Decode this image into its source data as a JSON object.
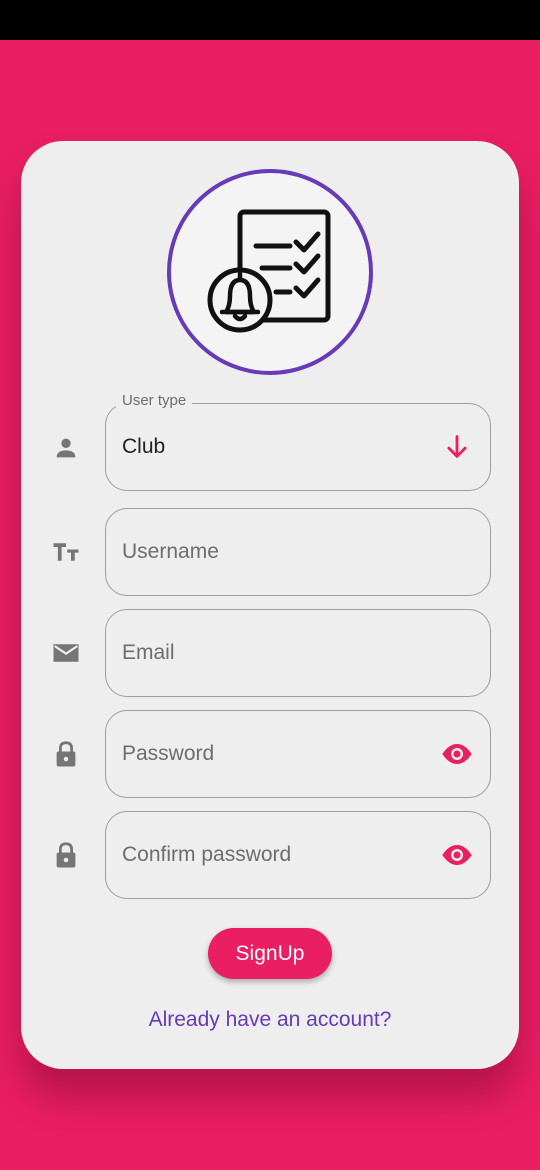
{
  "colors": {
    "background": "#e91e63",
    "accent": "#e91e63",
    "link": "#673ab7",
    "logo_ring": "#673ab7",
    "icon_gray": "#757575"
  },
  "logo": {
    "icon": "checklist-bell-icon"
  },
  "form": {
    "user_type": {
      "label": "User type",
      "value": "Club",
      "icon": "person-icon",
      "trailing_icon": "arrow-down-icon"
    },
    "username": {
      "placeholder": "Username",
      "icon": "text-fields-icon"
    },
    "email": {
      "placeholder": "Email",
      "icon": "mail-icon"
    },
    "password": {
      "placeholder": "Password",
      "icon": "lock-icon",
      "trailing_icon": "eye-icon"
    },
    "confirm_password": {
      "placeholder": "Confirm password",
      "icon": "lock-icon",
      "trailing_icon": "eye-icon"
    }
  },
  "actions": {
    "signup_label": "SignUp",
    "login_link": "Already have an account?"
  }
}
